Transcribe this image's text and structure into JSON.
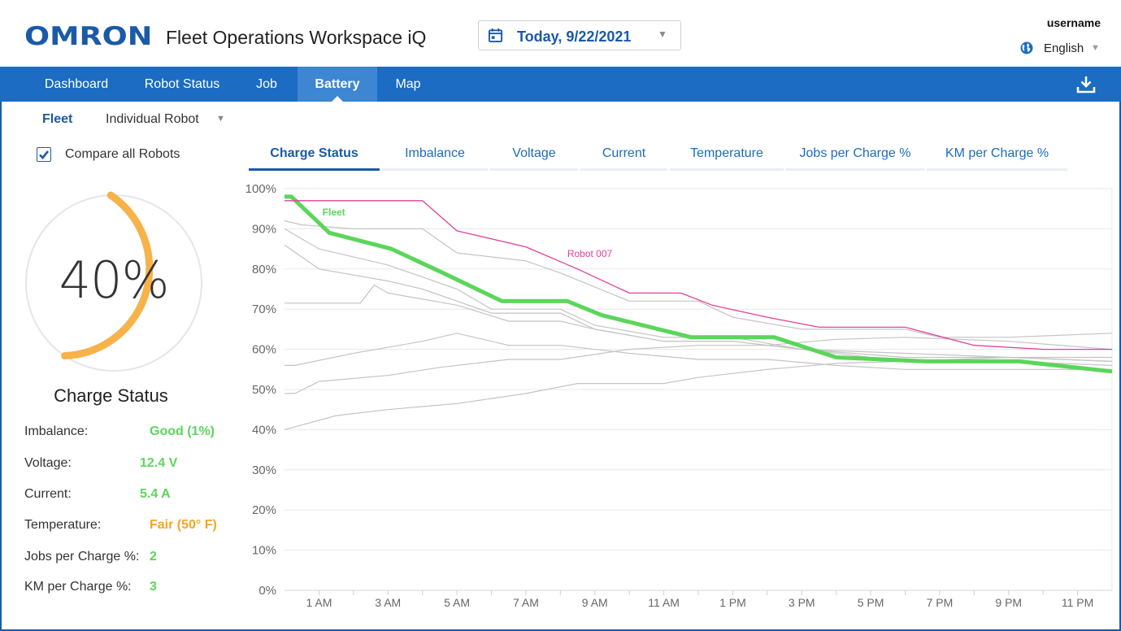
{
  "header": {
    "logo": "OMRON",
    "app_title": "Fleet Operations Workspace iQ",
    "date": "Today, 9/22/2021",
    "username": "username",
    "language": "English"
  },
  "nav": {
    "items": [
      {
        "label": "Dashboard"
      },
      {
        "label": "Robot Status"
      },
      {
        "label": "Job"
      },
      {
        "label": "Battery",
        "active": true
      },
      {
        "label": "Map"
      }
    ]
  },
  "selector": {
    "fleet": "Fleet",
    "individual": "Individual Robot",
    "compare_label": "Compare all Robots",
    "compare_checked": true
  },
  "gauge": {
    "value": "40%",
    "fraction": 0.4,
    "label": "Charge Status",
    "color": "#f7b24a"
  },
  "stats": [
    {
      "label": "Imbalance:",
      "value": "Good (1%)",
      "color": "#5cd65c"
    },
    {
      "label": "Voltage:",
      "value": "12.4 V",
      "color": "#5cd65c"
    },
    {
      "label": "Current:",
      "value": "5.4 A",
      "color": "#5cd65c"
    },
    {
      "label": "Temperature:",
      "value": "Fair (50° F)",
      "color": "#f5a623"
    },
    {
      "label": "Jobs per Charge %:",
      "value": "2",
      "color": "#5cd65c"
    },
    {
      "label": "KM per Charge %:",
      "value": "3",
      "color": "#5cd65c"
    }
  ],
  "chart_tabs": [
    {
      "label": "Charge Status",
      "active": true
    },
    {
      "label": "Imbalance"
    },
    {
      "label": "Voltage"
    },
    {
      "label": "Current"
    },
    {
      "label": "Temperature"
    },
    {
      "label": "Jobs per Charge %"
    },
    {
      "label": "KM per Charge %"
    }
  ],
  "chart_data": {
    "type": "line",
    "xlim": [
      0,
      24
    ],
    "ylim": [
      0,
      100
    ],
    "y_ticks": [
      "0%",
      "10%",
      "20%",
      "30%",
      "40%",
      "50%",
      "60%",
      "70%",
      "80%",
      "90%",
      "100%"
    ],
    "x_ticks": [
      {
        "x": 1,
        "label": "1 AM"
      },
      {
        "x": 3,
        "label": "3 AM"
      },
      {
        "x": 5,
        "label": "5 AM"
      },
      {
        "x": 7,
        "label": "7 AM"
      },
      {
        "x": 9,
        "label": "9 AM"
      },
      {
        "x": 11,
        "label": "11 AM"
      },
      {
        "x": 13,
        "label": "1 PM"
      },
      {
        "x": 15,
        "label": "3 PM"
      },
      {
        "x": 17,
        "label": "5 PM"
      },
      {
        "x": 19,
        "label": "7 PM"
      },
      {
        "x": 21,
        "label": "9 PM"
      },
      {
        "x": 23,
        "label": "11 PM"
      }
    ],
    "grid": true,
    "series": [
      {
        "name": "Fleet",
        "color": "#5ad65a",
        "width": 5,
        "label": true,
        "points": [
          [
            0,
            98
          ],
          [
            0.2,
            98
          ],
          [
            1.3,
            89
          ],
          [
            3.1,
            85
          ],
          [
            4.6,
            79
          ],
          [
            6.3,
            72
          ],
          [
            8.2,
            72
          ],
          [
            9.2,
            68.5
          ],
          [
            11.8,
            63
          ],
          [
            14.2,
            63
          ],
          [
            16,
            58
          ],
          [
            18.6,
            57
          ],
          [
            21.3,
            57
          ],
          [
            24,
            54.5
          ]
        ]
      },
      {
        "name": "Robot 007",
        "color": "#e0409a",
        "width": 1.3,
        "label": true,
        "points": [
          [
            0,
            97
          ],
          [
            4,
            97
          ],
          [
            5,
            89.5
          ],
          [
            7,
            85.5
          ],
          [
            8.5,
            80
          ],
          [
            10,
            74
          ],
          [
            11.5,
            74
          ],
          [
            12.4,
            71
          ],
          [
            14,
            68
          ],
          [
            15.5,
            65.5
          ],
          [
            18,
            65.5
          ],
          [
            20,
            61
          ],
          [
            22,
            60
          ],
          [
            24,
            60
          ]
        ]
      },
      {
        "color": "#c4c4c4",
        "width": 1.2,
        "points": [
          [
            0,
            92
          ],
          [
            0.5,
            91
          ],
          [
            2,
            90
          ],
          [
            4,
            90
          ],
          [
            5,
            84
          ],
          [
            7,
            82
          ],
          [
            8,
            79
          ],
          [
            10,
            72
          ],
          [
            12,
            72
          ],
          [
            13,
            68
          ],
          [
            15,
            65
          ],
          [
            18,
            65
          ],
          [
            19,
            63
          ],
          [
            21,
            63
          ],
          [
            24,
            64
          ]
        ]
      },
      {
        "color": "#c4c4c4",
        "width": 1.2,
        "points": [
          [
            0,
            90
          ],
          [
            1,
            85
          ],
          [
            3,
            81
          ],
          [
            5,
            75
          ],
          [
            6,
            70
          ],
          [
            8,
            70
          ],
          [
            9,
            66
          ],
          [
            11,
            63
          ],
          [
            13,
            63
          ],
          [
            15,
            60
          ],
          [
            18,
            59
          ],
          [
            21,
            58
          ],
          [
            24,
            57
          ]
        ]
      },
      {
        "color": "#c4c4c4",
        "width": 1.2,
        "points": [
          [
            0,
            86
          ],
          [
            1,
            80
          ],
          [
            3,
            77
          ],
          [
            4,
            75
          ],
          [
            6,
            69
          ],
          [
            8,
            69
          ],
          [
            9,
            65
          ],
          [
            11,
            62
          ],
          [
            13,
            62
          ],
          [
            15,
            60
          ],
          [
            18,
            57
          ],
          [
            21,
            57
          ],
          [
            24,
            56
          ]
        ]
      },
      {
        "color": "#c4c4c4",
        "width": 1.2,
        "points": [
          [
            0,
            71.5
          ],
          [
            2.2,
            71.5
          ],
          [
            2.6,
            76
          ],
          [
            3,
            74
          ],
          [
            5,
            71
          ],
          [
            6.5,
            67
          ],
          [
            8,
            67
          ],
          [
            9,
            65
          ],
          [
            11,
            62
          ],
          [
            13,
            62
          ],
          [
            15,
            60
          ],
          [
            18,
            58
          ],
          [
            21,
            58
          ],
          [
            24,
            57
          ]
        ]
      },
      {
        "color": "#c4c4c4",
        "width": 1.2,
        "points": [
          [
            0,
            56
          ],
          [
            0.3,
            56
          ],
          [
            2,
            59
          ],
          [
            4,
            62
          ],
          [
            5,
            64
          ],
          [
            6.5,
            61
          ],
          [
            8,
            61
          ],
          [
            10,
            59
          ],
          [
            12,
            57.5
          ],
          [
            14,
            57.5
          ],
          [
            16,
            56
          ],
          [
            18,
            55
          ],
          [
            21,
            55
          ],
          [
            24,
            55
          ]
        ]
      },
      {
        "color": "#c4c4c4",
        "width": 1.2,
        "points": [
          [
            0,
            49
          ],
          [
            0.3,
            49
          ],
          [
            1,
            52
          ],
          [
            3,
            53.5
          ],
          [
            4.5,
            55.5
          ],
          [
            6.5,
            57.5
          ],
          [
            8,
            57.5
          ],
          [
            10,
            60
          ],
          [
            12,
            61
          ],
          [
            14,
            61
          ],
          [
            16,
            62.5
          ],
          [
            18,
            63
          ],
          [
            21,
            62
          ],
          [
            24,
            60
          ]
        ]
      },
      {
        "color": "#c4c4c4",
        "width": 1.2,
        "points": [
          [
            0,
            40
          ],
          [
            1.5,
            43.5
          ],
          [
            3,
            45
          ],
          [
            5,
            46.5
          ],
          [
            7,
            49
          ],
          [
            8.5,
            51.5
          ],
          [
            11,
            51.5
          ],
          [
            12,
            53
          ],
          [
            14,
            55
          ],
          [
            16,
            56.5
          ],
          [
            18,
            57
          ],
          [
            21,
            58
          ],
          [
            24,
            58
          ]
        ]
      }
    ]
  }
}
